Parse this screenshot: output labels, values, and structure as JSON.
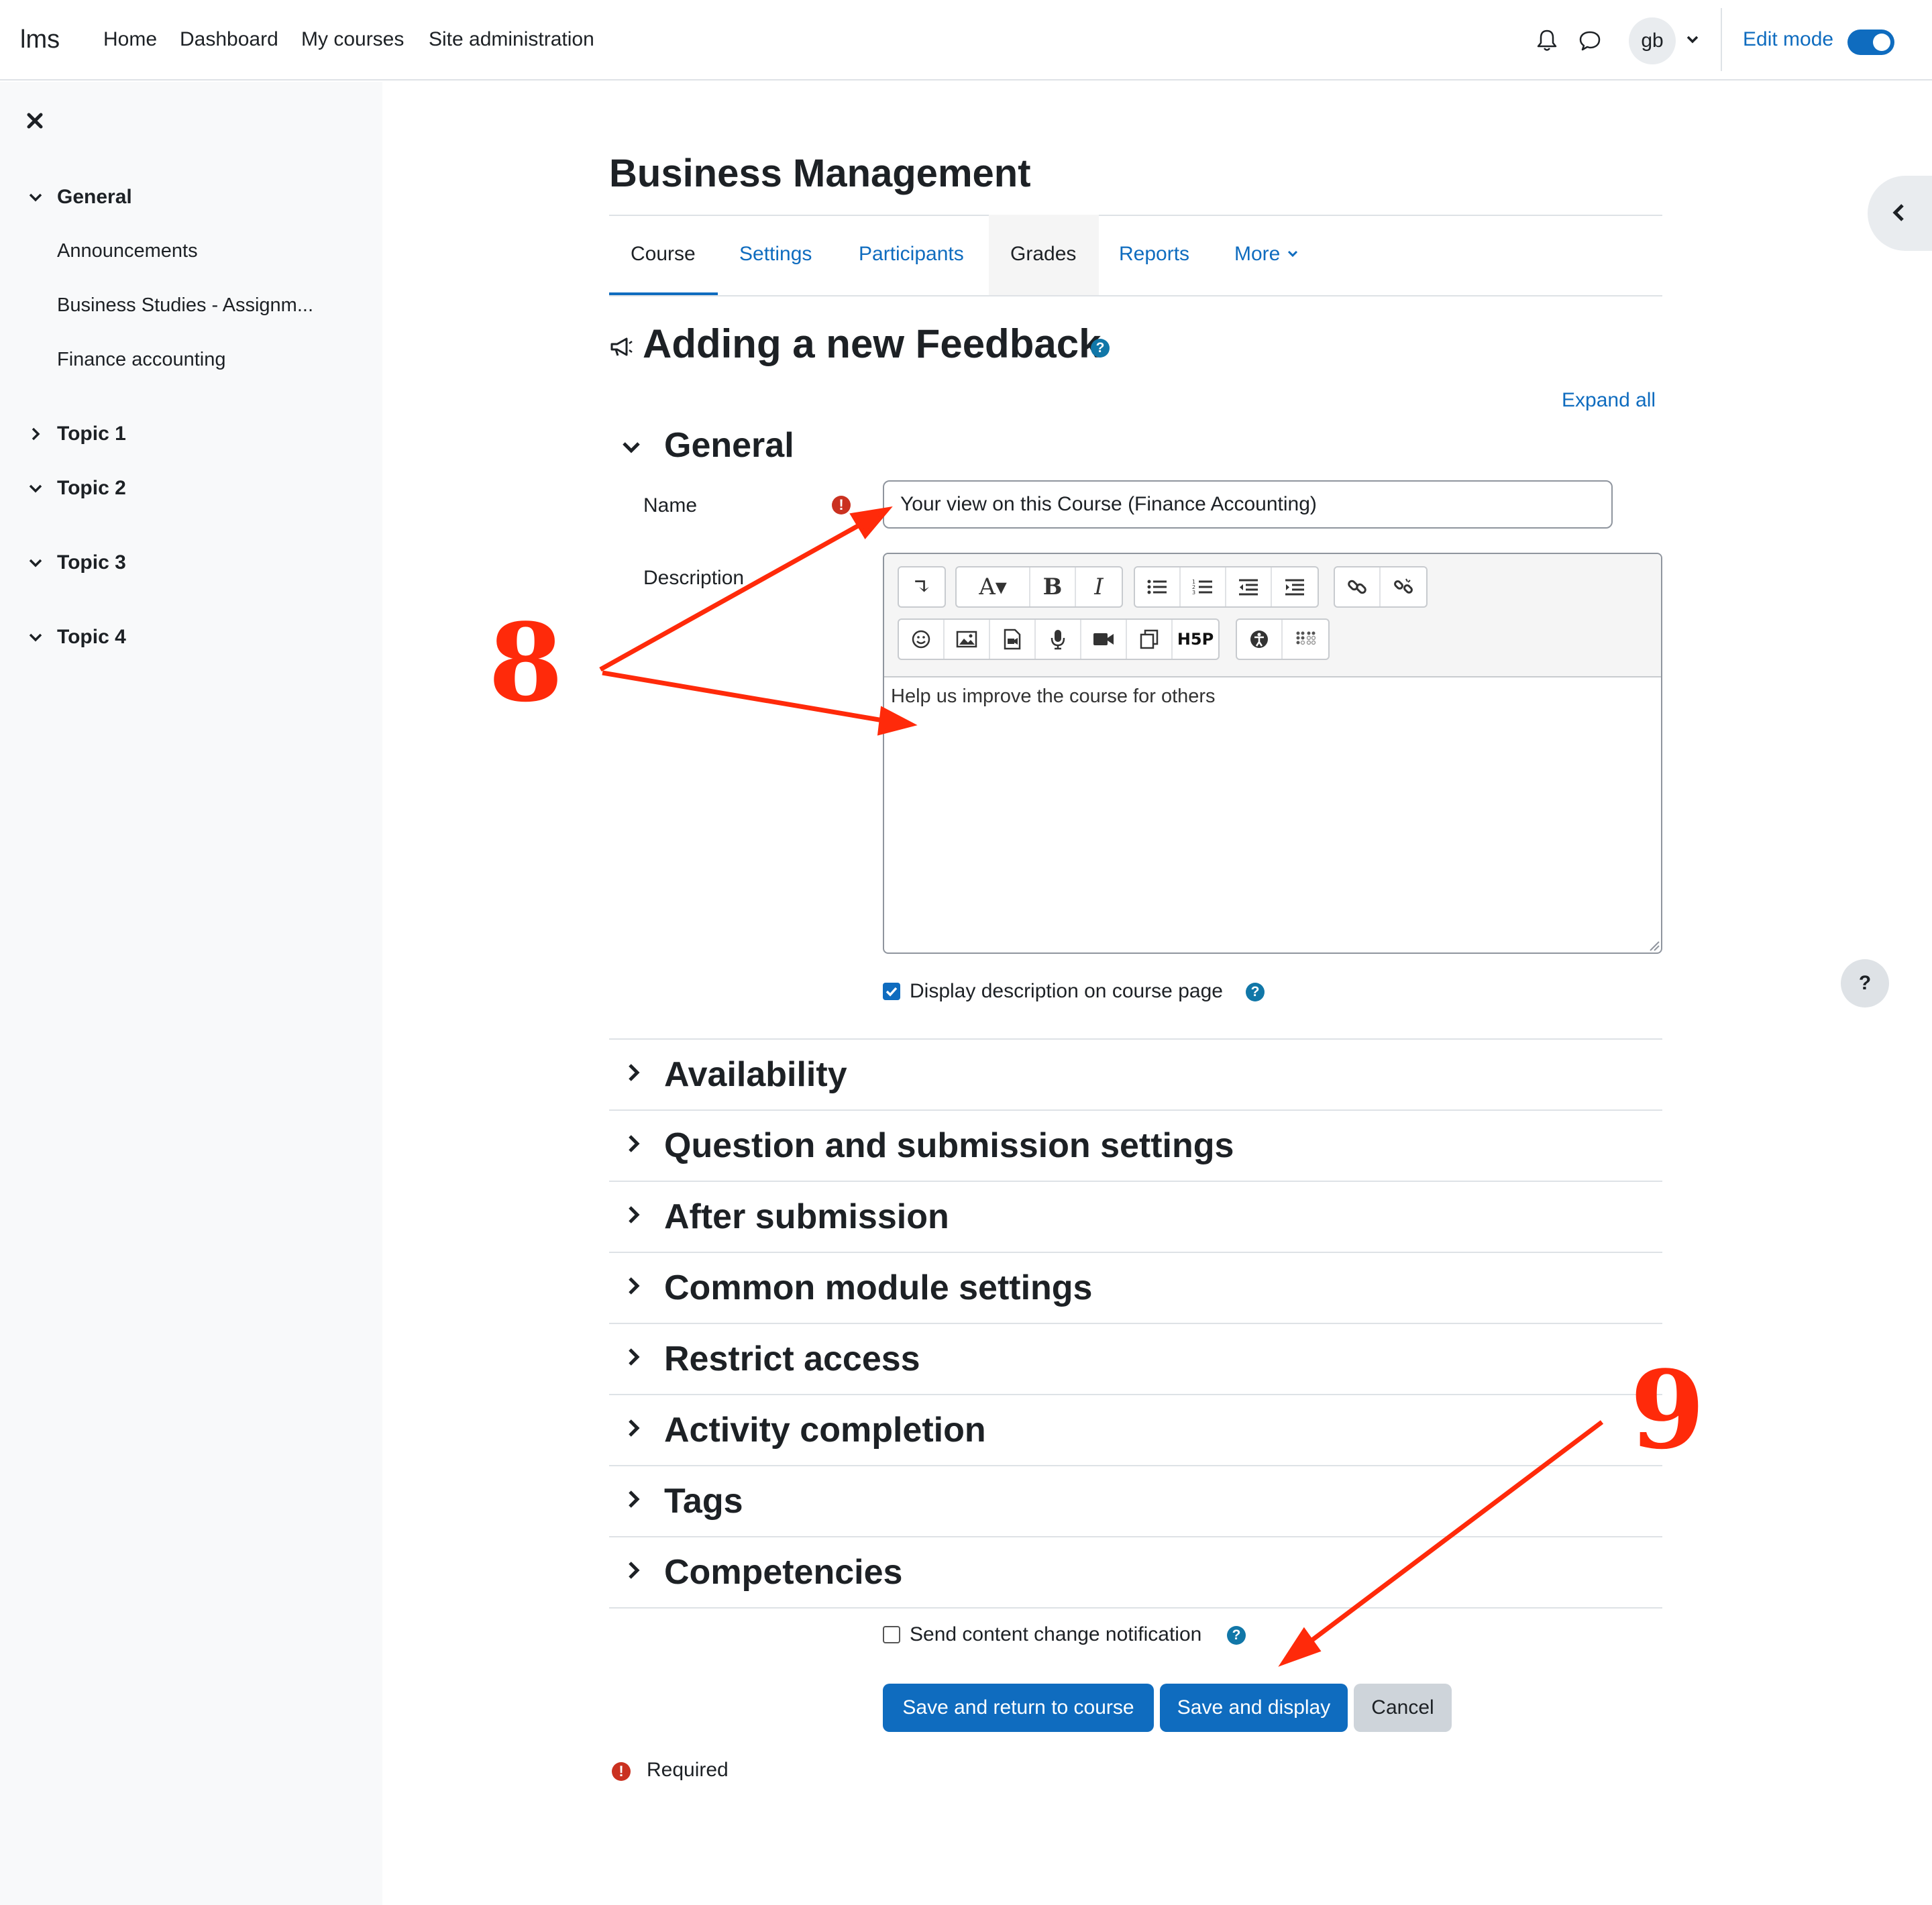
{
  "navbar": {
    "brand": "lms",
    "links": [
      "Home",
      "Dashboard",
      "My courses",
      "Site administration"
    ],
    "user_initials": "gb",
    "edit_mode_label": "Edit mode",
    "edit_mode_on": true,
    "icons": [
      "bell-icon",
      "chat-icon",
      "chevron-down-icon"
    ]
  },
  "drawer": {
    "sections": [
      {
        "title": "General",
        "expanded": true,
        "items": [
          "Announcements",
          "Business Studies - Assignm...",
          "Finance accounting"
        ]
      },
      {
        "title": "Topic 1",
        "expanded": false,
        "items": []
      },
      {
        "title": "Topic 2",
        "expanded": true,
        "items": []
      },
      {
        "title": "Topic 3",
        "expanded": true,
        "items": []
      },
      {
        "title": "Topic 4",
        "expanded": true,
        "items": []
      }
    ]
  },
  "course": {
    "title": "Business Management",
    "tabs": [
      "Course",
      "Settings",
      "Participants",
      "Grades",
      "Reports",
      "More"
    ],
    "active_tab": "Course"
  },
  "form": {
    "heading": "Adding a new Feedback",
    "expand_all": "Expand all",
    "general_title": "General",
    "name_label": "Name",
    "name_value": "Your view on this Course (Finance Accounting)",
    "description_label": "Description",
    "description_value": "Help us improve the course for others",
    "display_description_label": "Display description on course page",
    "display_description_checked": true,
    "sections": [
      "Availability",
      "Question and submission settings",
      "After submission",
      "Common module settings",
      "Restrict access",
      "Activity completion",
      "Tags",
      "Competencies"
    ],
    "notify_label": "Send content change notification",
    "notify_checked": false,
    "buttons": {
      "save_return": "Save and return to course",
      "save_display": "Save and display",
      "cancel": "Cancel"
    },
    "required_label": "Required"
  },
  "annotations": {
    "step_a": "8",
    "step_b": "9"
  },
  "colors": {
    "primary": "#0f6cbf",
    "required": "#ca3120",
    "help": "#1177a8",
    "annotation": "#ff2a0a"
  }
}
